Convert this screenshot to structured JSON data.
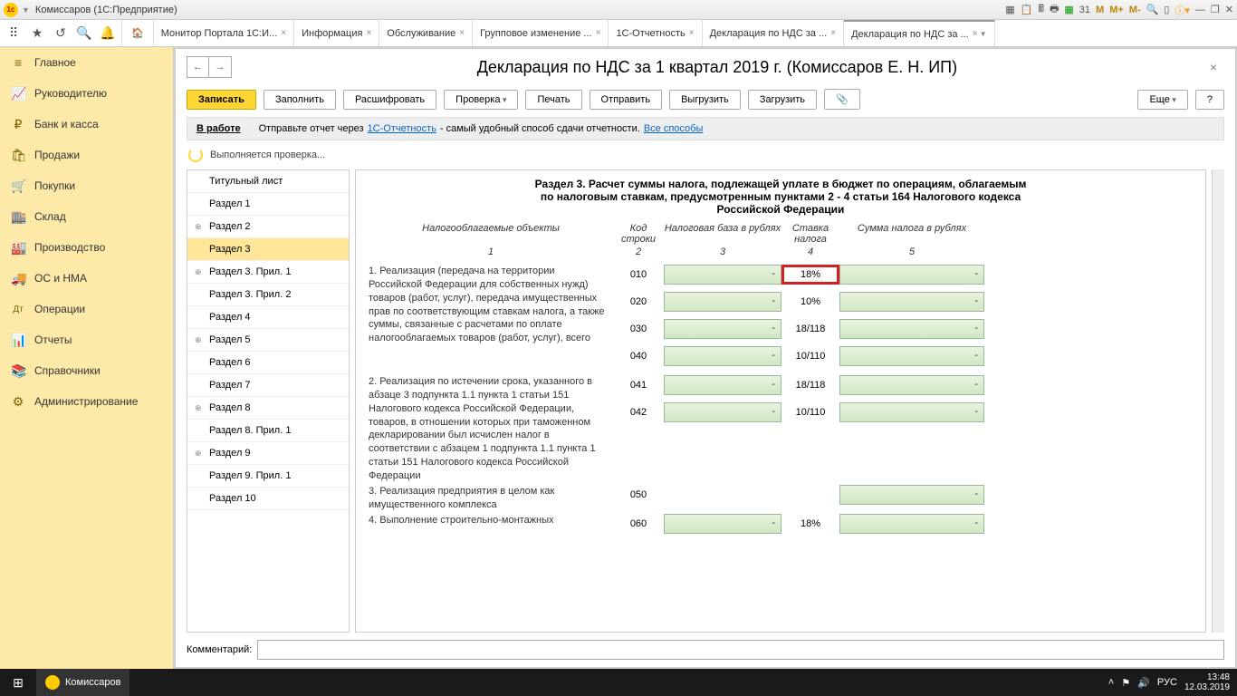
{
  "window": {
    "title": "Комиссаров  (1С:Предприятие)"
  },
  "top_tabs": [
    {
      "label": "Монитор Портала 1С:И...",
      "closable": true
    },
    {
      "label": "Информация",
      "closable": true
    },
    {
      "label": "Обслуживание",
      "closable": true
    },
    {
      "label": "Групповое изменение ...",
      "closable": true
    },
    {
      "label": "1С-Отчетность",
      "closable": true
    },
    {
      "label": "Декларация по НДС за ...",
      "closable": true
    },
    {
      "label": "Декларация по НДС за ...",
      "closable": true,
      "active": true
    }
  ],
  "sidebar": {
    "items": [
      {
        "icon": "≡",
        "label": "Главное"
      },
      {
        "icon": "📈",
        "label": "Руководителю"
      },
      {
        "icon": "₽",
        "label": "Банк и касса"
      },
      {
        "icon": "🛍",
        "label": "Продажи"
      },
      {
        "icon": "🛒",
        "label": "Покупки"
      },
      {
        "icon": "🏬",
        "label": "Склад"
      },
      {
        "icon": "🏭",
        "label": "Производство"
      },
      {
        "icon": "🚚",
        "label": "ОС и НМА"
      },
      {
        "icon": "Дт",
        "label": "Операции"
      },
      {
        "icon": "📊",
        "label": "Отчеты"
      },
      {
        "icon": "📚",
        "label": "Справочники"
      },
      {
        "icon": "⚙",
        "label": "Администрирование"
      }
    ]
  },
  "page": {
    "title": "Декларация по НДС за 1 квартал 2019 г. (Комиссаров Е. Н. ИП)",
    "buttons": {
      "save": "Записать",
      "fill": "Заполнить",
      "decode": "Расшифровать",
      "check": "Проверка",
      "print": "Печать",
      "send": "Отправить",
      "export": "Выгрузить",
      "import": "Загрузить",
      "more": "Еще",
      "help": "?"
    },
    "status": {
      "label": "В работе",
      "text1": "Отправьте отчет через ",
      "link1": "1С-Отчетность",
      "text2": " - самый удобный способ сдачи отчетности. ",
      "link2": "Все способы"
    },
    "progress": "Выполняется проверка...",
    "comment_label": "Комментарий:"
  },
  "sections": [
    {
      "label": "Титульный лист"
    },
    {
      "label": "Раздел 1"
    },
    {
      "label": "Раздел 2",
      "children": true
    },
    {
      "label": "Раздел 3",
      "selected": true
    },
    {
      "label": "Раздел 3. Прил. 1",
      "children": true
    },
    {
      "label": "Раздел 3. Прил. 2"
    },
    {
      "label": "Раздел 4"
    },
    {
      "label": "Раздел 5",
      "children": true
    },
    {
      "label": "Раздел 6"
    },
    {
      "label": "Раздел 7"
    },
    {
      "label": "Раздел 8",
      "children": true
    },
    {
      "label": "Раздел 8. Прил. 1"
    },
    {
      "label": "Раздел 9",
      "children": true
    },
    {
      "label": "Раздел 9. Прил. 1"
    },
    {
      "label": "Раздел 10"
    }
  ],
  "form": {
    "title1": "Раздел 3. Расчет суммы налога, подлежащей уплате в бюджет по операциям, облагаемым",
    "title2": "по налоговым ставкам, предусмотренным пунктами 2 - 4 статьи 164 Налогового кодекса",
    "title3": "Российской Федерации",
    "headers": {
      "c1": "Налогооблагаемые объекты",
      "c2": "Код строки",
      "c3": "Налоговая база в рублях",
      "c4": "Ставка налога",
      "c5": "Сумма налога в рублях"
    },
    "col_nums": {
      "c1": "1",
      "c2": "2",
      "c3": "3",
      "c4": "4",
      "c5": "5"
    },
    "blocks": [
      {
        "desc": "1. Реализация (передача на территории Российской Федерации для собственных нужд) товаров (работ, услуг), передача имущественных прав по соответствующим ставкам налога, а также суммы, связанные с расчетами по оплате налогооблагаемых товаров (работ, услуг), всего",
        "rows": [
          {
            "code": "010",
            "rate": "18%",
            "highlight": true
          },
          {
            "code": "020",
            "rate": "10%"
          },
          {
            "code": "030",
            "rate": "18/118"
          },
          {
            "code": "040",
            "rate": "10/110"
          }
        ]
      },
      {
        "desc": "2. Реализация по истечении срока, указанного в абзаце 3 подпункта 1.1 пункта 1 статьи 151 Налогового кодекса Российской Федерации, товаров, в отношении которых при таможенном декларировании был исчислен налог в соответствии с абзацем 1 подпункта 1.1 пункта 1 статьи 151 Налогового кодекса Российской Федерации",
        "rows": [
          {
            "code": "041",
            "rate": "18/118"
          },
          {
            "code": "042",
            "rate": "10/110"
          }
        ]
      },
      {
        "desc": "3. Реализация предприятия в целом как имущественного комплекса",
        "rows": [
          {
            "code": "050",
            "rate": "",
            "no_base": true
          }
        ]
      },
      {
        "desc": "4. Выполнение строительно-монтажных",
        "rows": [
          {
            "code": "060",
            "rate": "18%"
          }
        ]
      }
    ]
  },
  "taskbar": {
    "app": "Комиссаров",
    "lang": "РУС",
    "time": "13:48",
    "date": "12.03.2019"
  }
}
